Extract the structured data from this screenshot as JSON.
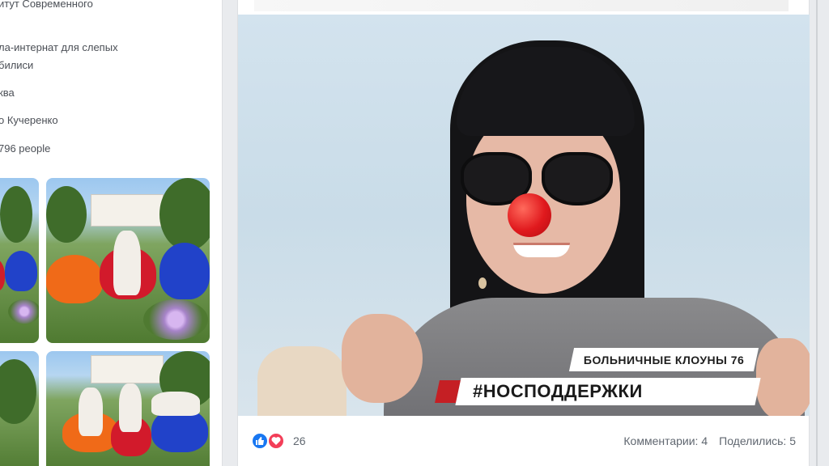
{
  "sidebar": {
    "info": [
      {
        "text": "итут Современного"
      },
      {
        "text": "ла-интернат для слепых"
      },
      {
        "text": "билиси"
      },
      {
        "text": "ква"
      },
      {
        "text": "о Кучеренко"
      },
      {
        "text": "796 people"
      }
    ]
  },
  "post": {
    "overlay": {
      "small_caption": "БОЛЬНИЧНЫЕ КЛОУНЫ 76",
      "hashtag": "#НОСПОДДЕРЖКИ"
    },
    "reactions": {
      "like_icon": "thumbs-up-icon",
      "love_icon": "heart-icon",
      "count": "26"
    },
    "comments": "Комментарии: 4",
    "shares": "Поделились: 5"
  },
  "colors": {
    "accent_red": "#c51f24",
    "like_blue": "#1877f2",
    "love_red": "#f33e58"
  }
}
